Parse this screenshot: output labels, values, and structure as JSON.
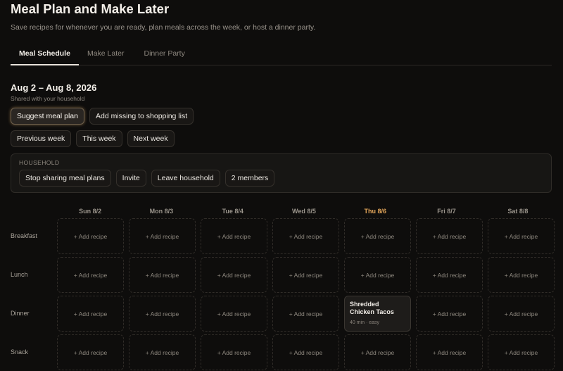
{
  "page": {
    "title": "Meal Plan and Make Later",
    "subtitle": "Save recipes for whenever you are ready, plan meals across the week, or host a dinner party."
  },
  "tabs": [
    {
      "label": "Meal Schedule",
      "active": true
    },
    {
      "label": "Make Later",
      "active": false
    },
    {
      "label": "Dinner Party",
      "active": false
    }
  ],
  "week": {
    "range": "Aug 2 – Aug 8, 2026",
    "shared_note": "Shared with your household"
  },
  "actions": {
    "suggest": "Suggest meal plan",
    "add_missing": "Add missing to shopping list",
    "previous_week": "Previous week",
    "this_week": "This week",
    "next_week": "Next week"
  },
  "household": {
    "label": "HOUSEHOLD",
    "stop_sharing": "Stop sharing meal plans",
    "invite": "Invite",
    "leave": "Leave household",
    "members": "2 members"
  },
  "schedule": {
    "days": [
      "Sun 8/2",
      "Mon 8/3",
      "Tue 8/4",
      "Wed 8/5",
      "Thu 8/6",
      "Fri 8/7",
      "Sat 8/8"
    ],
    "today": "Thu 8/6",
    "meals": [
      "Breakfast",
      "Lunch",
      "Dinner",
      "Snack"
    ],
    "add_label": "+ Add recipe",
    "planned": {
      "meal": "Dinner",
      "day": "Thu 8/6",
      "name": "Shredded Chicken Tacos",
      "meta": "40 min · easy"
    }
  },
  "colors": {
    "background": "#0e0d0c",
    "accent_today": "#e3a65a",
    "primary_glow": "#e6b46e"
  }
}
